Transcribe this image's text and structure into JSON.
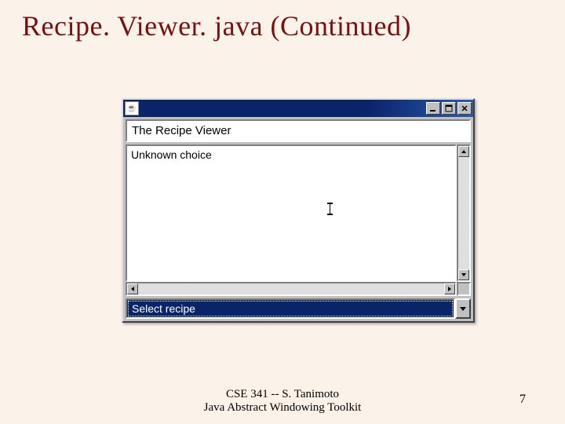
{
  "slide": {
    "title": "Recipe. Viewer. java (Continued)",
    "footer_line1": "CSE 341 -- S. Tanimoto",
    "footer_line2": "Java Abstract Windowing Toolkit",
    "page_number": "7"
  },
  "window": {
    "icon_glyph": "☕",
    "header_label": "The Recipe Viewer",
    "textarea_content": "Unknown choice",
    "select_value": "Select recipe"
  }
}
